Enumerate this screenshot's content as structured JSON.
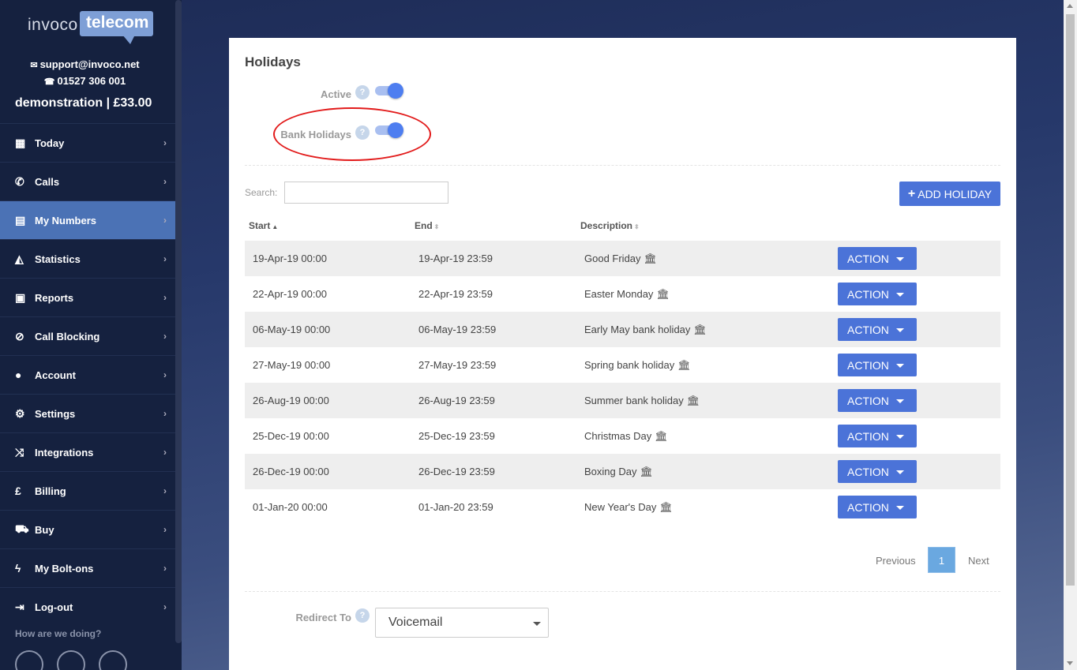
{
  "brand": {
    "logo_left": "invoco",
    "logo_right": "telecom"
  },
  "contact": {
    "email": "support@invoco.net",
    "phone": "01527 306 001"
  },
  "account_line": "demonstration | £33.00",
  "nav": [
    {
      "label": "Today",
      "icon": "calendar-icon",
      "glyph": "▦"
    },
    {
      "label": "Calls",
      "icon": "phone-icon",
      "glyph": "✆"
    },
    {
      "label": "My Numbers",
      "icon": "numbers-icon",
      "glyph": "▤",
      "active": true
    },
    {
      "label": "Statistics",
      "icon": "area-chart-icon",
      "glyph": "◭"
    },
    {
      "label": "Reports",
      "icon": "newspaper-icon",
      "glyph": "▣"
    },
    {
      "label": "Call Blocking",
      "icon": "ban-icon",
      "glyph": "⊘"
    },
    {
      "label": "Account",
      "icon": "user-icon",
      "glyph": "●"
    },
    {
      "label": "Settings",
      "icon": "cogs-icon",
      "glyph": "⚙"
    },
    {
      "label": "Integrations",
      "icon": "shuffle-icon",
      "glyph": "⤨"
    },
    {
      "label": "Billing",
      "icon": "pound-icon",
      "glyph": "£"
    },
    {
      "label": "Buy",
      "icon": "cart-icon",
      "glyph": "⛟"
    },
    {
      "label": "My Bolt-ons",
      "icon": "bolt-icon",
      "glyph": "ϟ"
    },
    {
      "label": "Log-out",
      "icon": "sign-out-icon",
      "glyph": "⇥"
    }
  ],
  "feedback_label": "How are we doing?",
  "page": {
    "title": "Holidays",
    "active_label": "Active",
    "active_on": true,
    "bank_holidays_label": "Bank Holidays",
    "bank_holidays_on": true,
    "help_glyph": "?",
    "search_label": "Search:",
    "search_value": "",
    "add_button": "ADD HOLIDAY",
    "columns": {
      "start": "Start",
      "end": "End",
      "description": "Description"
    },
    "action_label": "ACTION",
    "rows": [
      {
        "start": "19-Apr-19 00:00",
        "end": "19-Apr-19 23:59",
        "description": "Good Friday"
      },
      {
        "start": "22-Apr-19 00:00",
        "end": "22-Apr-19 23:59",
        "description": "Easter Monday"
      },
      {
        "start": "06-May-19 00:00",
        "end": "06-May-19 23:59",
        "description": "Early May bank holiday"
      },
      {
        "start": "27-May-19 00:00",
        "end": "27-May-19 23:59",
        "description": "Spring bank holiday"
      },
      {
        "start": "26-Aug-19 00:00",
        "end": "26-Aug-19 23:59",
        "description": "Summer bank holiday"
      },
      {
        "start": "25-Dec-19 00:00",
        "end": "25-Dec-19 23:59",
        "description": "Christmas Day"
      },
      {
        "start": "26-Dec-19 00:00",
        "end": "26-Dec-19 23:59",
        "description": "Boxing Day"
      },
      {
        "start": "01-Jan-20 00:00",
        "end": "01-Jan-20 23:59",
        "description": "New Year's Day"
      }
    ],
    "pagination": {
      "previous": "Previous",
      "current": "1",
      "next": "Next"
    },
    "redirect_label": "Redirect To",
    "redirect_value": "Voicemail"
  },
  "colors": {
    "primary_button": "#4b73d8",
    "sidebar_bg": "#15213f",
    "active_nav": "#4b72b5",
    "annotation": "#e21b1b"
  }
}
